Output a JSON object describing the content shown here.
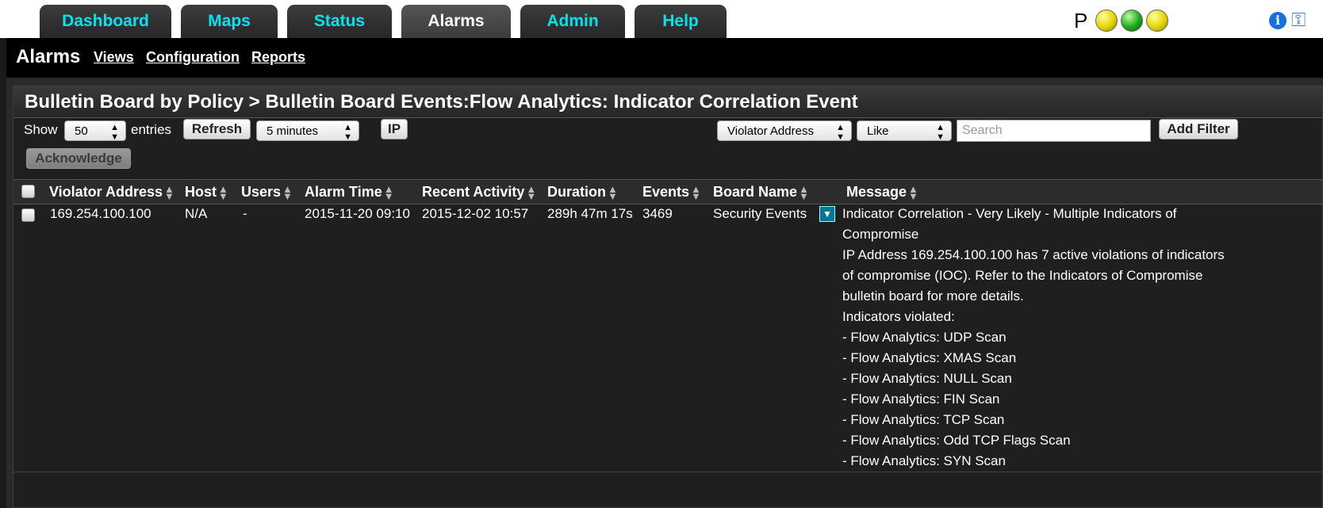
{
  "tabs": [
    {
      "label": "Dashboard",
      "active": false
    },
    {
      "label": "Maps",
      "active": false
    },
    {
      "label": "Status",
      "active": false
    },
    {
      "label": "Alarms",
      "active": true
    },
    {
      "label": "Admin",
      "active": false
    },
    {
      "label": "Help",
      "active": false
    }
  ],
  "status": {
    "letter": "P",
    "leds": [
      "yellow",
      "green",
      "yellow"
    ],
    "icons": [
      "info-icon",
      "key-icon"
    ]
  },
  "subnav": {
    "title": "Alarms",
    "links": [
      "Views",
      "Configuration",
      "Reports"
    ]
  },
  "panel": {
    "title": "Bulletin Board by Policy > Bulletin Board Events:Flow Analytics: Indicator Correlation Event"
  },
  "controls": {
    "show_label": "Show",
    "entries_value": "50",
    "entries_label": "entries",
    "refresh_label": "Refresh",
    "interval_value": "5 minutes",
    "ip_label": "IP",
    "filter_field": "Violator Address",
    "filter_op": "Like",
    "search_placeholder": "Search",
    "add_filter_label": "Add Filter",
    "acknowledge_label": "Acknowledge"
  },
  "table": {
    "columns": [
      "Violator Address",
      "Host",
      "Users",
      "Alarm Time",
      "Recent Activity",
      "Duration",
      "Events",
      "Board Name",
      "Message"
    ],
    "rows": [
      {
        "violator_address": "169.254.100.100",
        "host": "N/A",
        "users": "-",
        "alarm_time": "2015-11-20 09:10",
        "recent_activity": "2015-12-02 10:57",
        "duration": "289h 47m 17s",
        "events": "3469",
        "board_name": "Security Events",
        "message_lines": [
          "Indicator Correlation - Very Likely - Multiple Indicators of",
          "Compromise",
          "IP Address 169.254.100.100 has 7 active violations of indicators",
          "of compromise (IOC). Refer to the Indicators of Compromise",
          "bulletin board for more details.",
          "Indicators violated:",
          "- Flow Analytics: UDP Scan",
          "- Flow Analytics: XMAS Scan",
          "- Flow Analytics: NULL Scan",
          "- Flow Analytics: FIN Scan",
          "- Flow Analytics: TCP Scan",
          "- Flow Analytics: Odd TCP Flags Scan",
          "- Flow Analytics: SYN Scan"
        ]
      }
    ]
  }
}
